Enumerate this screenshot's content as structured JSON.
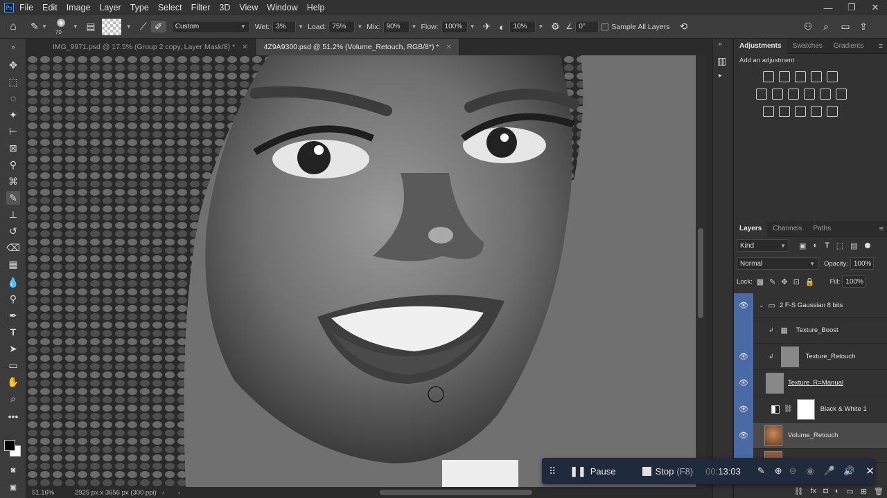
{
  "menubar": {
    "logo": "Ps",
    "items": [
      "File",
      "Edit",
      "Image",
      "Layer",
      "Type",
      "Select",
      "Filter",
      "3D",
      "View",
      "Window",
      "Help"
    ]
  },
  "options": {
    "brush_size": "70",
    "preset": "Custom",
    "wet_label": "Wet:",
    "wet_value": "3%",
    "load_label": "Load:",
    "load_value": "75%",
    "mix_label": "Mix:",
    "mix_value": "90%",
    "flow_label": "Flow:",
    "flow_value": "100%",
    "smoothing_value": "10%",
    "angle_value": "0°",
    "sample_all_label": "Sample All Layers"
  },
  "tabs": [
    {
      "label": "IMG_9971.psd @ 17.5% (Group 2 copy, Layer Mask/8) *",
      "active": false
    },
    {
      "label": "4Z9A9300.psd @ 51.2% (Volume_Retouch, RGB/8*) *",
      "active": true
    }
  ],
  "status": {
    "zoom": "51.16%",
    "doc_info": "2925 px x 3656 px (300 ppi)"
  },
  "adjustments_panel": {
    "tabs": [
      "Adjustments",
      "Swatches",
      "Gradients"
    ],
    "add_label": "Add an adjustment"
  },
  "layers_panel": {
    "tabs": [
      "Layers",
      "Channels",
      "Paths"
    ],
    "filter_kind": "Kind",
    "blend_mode": "Normal",
    "opacity_label": "Opacity:",
    "opacity_value": "100%",
    "lock_label": "Lock:",
    "fill_label": "Fill:",
    "fill_value": "100%",
    "layers": [
      {
        "name": "2 F-S Gaussian 8 bits",
        "visible": true
      },
      {
        "name": "Texture_Boost",
        "visible": false
      },
      {
        "name": "Texture_Retouch",
        "visible": true
      },
      {
        "name": "Texture_R=Manual",
        "visible": true
      },
      {
        "name": "Black & White 1",
        "visible": true
      },
      {
        "name": "Volume_Retouch",
        "visible": true
      }
    ]
  },
  "recorder": {
    "pause_label": "Pause",
    "stop_label": "Stop",
    "stop_shortcut": "(F8)",
    "time_prefix": "00:",
    "time": "13:03"
  },
  "colors": {
    "accent": "#4a6aa5",
    "recorder_bg": "#1f2a3a"
  }
}
